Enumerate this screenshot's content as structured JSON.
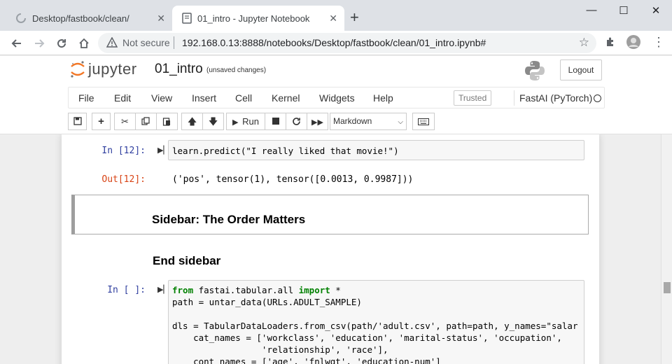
{
  "browser": {
    "tabs": [
      {
        "title": "Desktop/fastbook/clean/",
        "close": "✕",
        "active": false
      },
      {
        "title": "01_intro - Jupyter Notebook",
        "close": "✕",
        "active": true
      }
    ],
    "new_tab": "+",
    "window": {
      "minimize": "—",
      "maximize": "☐",
      "close": "✕"
    },
    "security_label": "Not secure",
    "url": "192.168.0.13:8888/notebooks/Desktop/fastbook/clean/01_intro.ipynb#",
    "icons": {
      "back": "arrow-left-icon",
      "forward": "arrow-right-icon",
      "reload": "reload-icon",
      "home": "home-icon",
      "warning": "warning-triangle-icon",
      "bookmark": "star-icon",
      "extensions": "puzzle-icon",
      "menu": "kebab-menu-icon"
    }
  },
  "jupyter": {
    "logo_text": "jupyter",
    "notebook_name": "01_intro",
    "save_status": "(unsaved changes)",
    "logout_label": "Logout",
    "menus": [
      "File",
      "Edit",
      "View",
      "Insert",
      "Cell",
      "Kernel",
      "Widgets",
      "Help"
    ],
    "trusted_label": "Trusted",
    "kernel_name": "FastAI (PyTorch)",
    "toolbar": {
      "run_label": "Run",
      "cell_type": "Markdown"
    }
  },
  "cells": {
    "in12_prompt": "In [12]:",
    "in12_code": "learn.predict(\"I really liked that movie!\")",
    "out12_prompt": "Out[12]:",
    "out12_text": "('pos', tensor(1), tensor([0.0013, 0.9987]))",
    "md_sidebar_heading": "Sidebar: The Order Matters",
    "md_end_heading": "End sidebar",
    "in_empty_prompt": "In [ ]:",
    "code_lines": [
      "from fastai.tabular.all import *",
      "path = untar_data(URLs.ADULT_SAMPLE)",
      "",
      "dls = TabularDataLoaders.from_csv(path/'adult.csv', path=path, y_names=\"salar",
      "    cat_names = ['workclass', 'education', 'marital-status', 'occupation',",
      "                 'relationship', 'race'],",
      "    cont_names = ['age', 'fnlwgt', 'education-num']"
    ]
  }
}
